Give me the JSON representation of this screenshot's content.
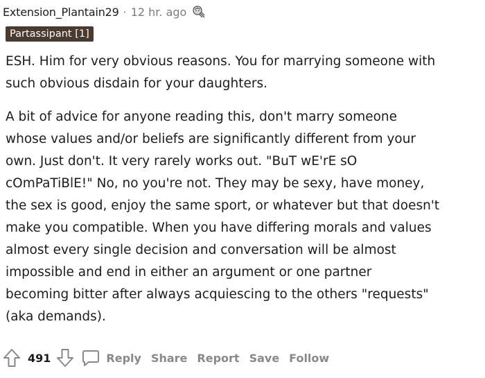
{
  "comment": {
    "username": "Extension_Plantain29",
    "separator": "·",
    "timestamp": "12 hr. ago",
    "award_icon": "award-icon",
    "flair": "Partassipant [1]",
    "paragraphs": [
      "ESH. Him for very obvious reasons. You for marrying someone with\nsuch obvious disdain for your daughters.",
      "A bit of advice for anyone reading this, don't marry someone\nwhose values and/or beliefs are significantly different from your\nown. Just don't. It very rarely works out. \"BuT wE'rE sO\ncOmPaTiBlE!\" No, no you're not. They may be sexy, have money,\nthe sex is good, enjoy the same sport, or whatever but that doesn't\nmake you compatible. When you have differing morals and values\nalmost every single decision and conversation will be almost\nimpossible and end in either an argument or one partner\nbecoming bitter after always acquiescing to the others \"requests\"\n(aka demands)."
    ],
    "actions": {
      "upvote_icon": "upvote-icon",
      "score": "491",
      "downvote_icon": "downvote-icon",
      "comment_icon": "comment-bubble-icon",
      "reply": "Reply",
      "share": "Share",
      "report": "Report",
      "save": "Save",
      "follow": "Follow"
    }
  },
  "colors": {
    "flair_bg": "#4a3a30",
    "meta_gray": "#7c7c7c",
    "action_gray": "#878a8c",
    "text": "#1c1c1c"
  }
}
